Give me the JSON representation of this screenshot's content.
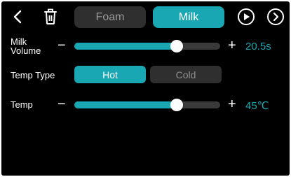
{
  "colors": {
    "accent": "#19a8b3",
    "background": "#000000",
    "inactive": "#2f2f2f"
  },
  "header": {
    "icons": [
      "back-arrow-icon",
      "trash-icon",
      "play-circle-icon",
      "next-circle-icon"
    ],
    "tabs": [
      {
        "label": "Foam",
        "active": false
      },
      {
        "label": "Milk",
        "active": true
      }
    ]
  },
  "milk_volume": {
    "label_line1": "Milk",
    "label_line2": "Volume",
    "minus": "−",
    "plus": "+",
    "value": "20.5s",
    "level": 0.7
  },
  "temp_type": {
    "label": "Temp Type",
    "options": [
      {
        "label": "Hot",
        "active": true
      },
      {
        "label": "Cold",
        "active": false
      }
    ]
  },
  "temp": {
    "label": "Temp",
    "minus": "−",
    "plus": "+",
    "value": "45℃",
    "level": 0.7
  }
}
